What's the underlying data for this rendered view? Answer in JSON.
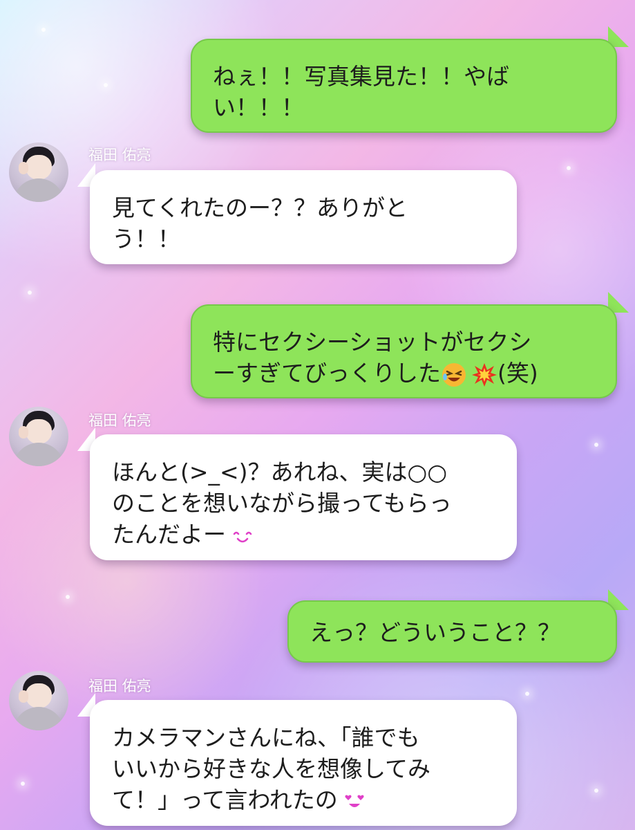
{
  "messages": [
    {
      "type": "sent",
      "lines": [
        "ねぇ！！写真集見た！！やば",
        "い！！！"
      ]
    },
    {
      "type": "received",
      "sender": "福田 佑亮",
      "lines": [
        "見てくれたのー？？ありがと",
        "う！！"
      ]
    },
    {
      "type": "sent",
      "lines": [
        "特にセクシーショットがセクシ",
        "ーすぎてびっくりした",
        "(笑)"
      ]
    },
    {
      "type": "received",
      "sender": "福田 佑亮",
      "lines": [
        "ほんと(>_<)？あれね、実は○○",
        "のことを想いながら撮ってもらっ",
        "たんだよー"
      ]
    },
    {
      "type": "sent",
      "lines": [
        "えっ？どういうこと？？"
      ]
    },
    {
      "type": "received",
      "sender": "福田 佑亮",
      "lines": [
        "カメラマンさんにね、「誰でも",
        "いいから好きな人を想像してみ",
        "て！」って言われたの"
      ]
    }
  ],
  "emojis": {
    "m3": [
      "laughing-face-emoji",
      "collision-emoji"
    ],
    "m4": [
      "smiling-face-emoji"
    ],
    "m6": [
      "heart-eyes-face-emoji"
    ]
  }
}
